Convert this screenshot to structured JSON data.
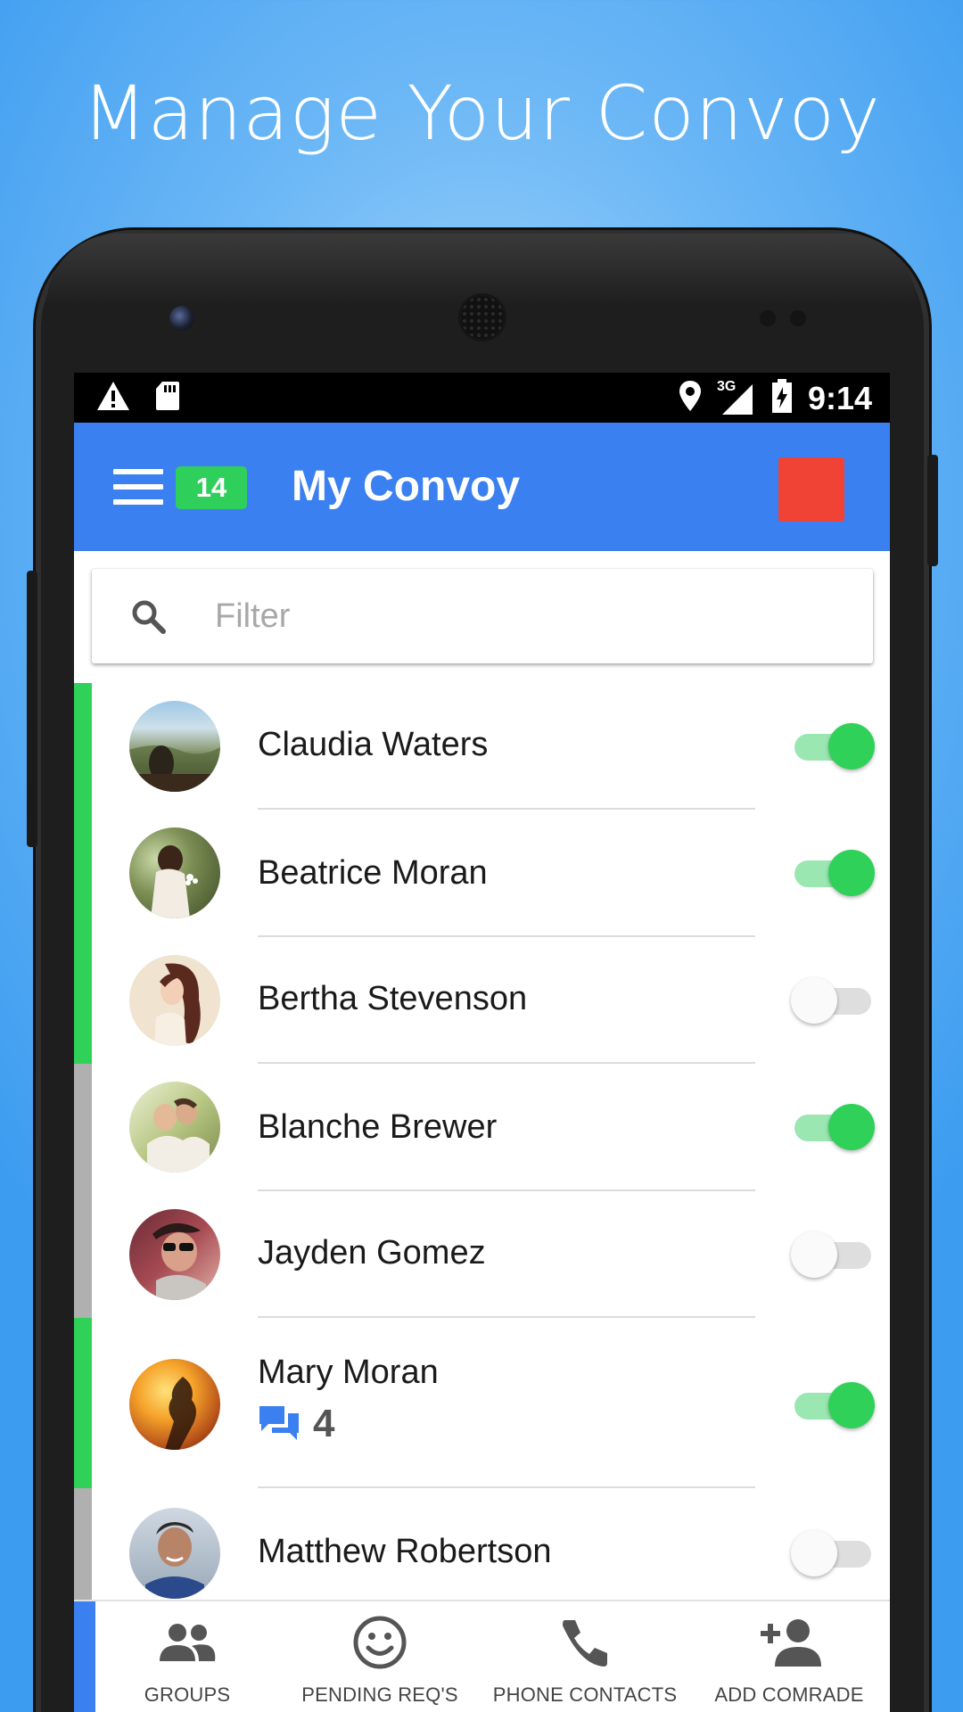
{
  "headline": "Manage Your Convoy",
  "status_bar": {
    "time": "9:14",
    "network": "3G"
  },
  "app_bar": {
    "badge_count": "14",
    "title": "My Convoy"
  },
  "filter": {
    "placeholder": "Filter",
    "value": ""
  },
  "colors": {
    "accent_blue": "#3b80f0",
    "online_green": "#2fd158",
    "offline_gray": "#b0b0b0",
    "alert_red": "#f04336"
  },
  "contacts": [
    {
      "name": "Claudia Waters",
      "enabled": true,
      "stripe": "green",
      "avatar": "landscape-avatar"
    },
    {
      "name": "Beatrice Moran",
      "enabled": true,
      "stripe": "green",
      "avatar": "woman-flowers-avatar"
    },
    {
      "name": "Bertha Stevenson",
      "enabled": false,
      "stripe": "green",
      "avatar": "woman-illustration-avatar"
    },
    {
      "name": "Blanche Brewer",
      "enabled": true,
      "stripe": "gray",
      "avatar": "couple-avatar"
    },
    {
      "name": "Jayden Gomez",
      "enabled": false,
      "stripe": "gray",
      "avatar": "man-sunglasses-avatar"
    },
    {
      "name": "Mary Moran",
      "enabled": true,
      "stripe": "green",
      "avatar": "sunset-silhouette-avatar",
      "messages": "4"
    },
    {
      "name": "Matthew Robertson",
      "enabled": false,
      "stripe": "gray",
      "avatar": "man-portrait-avatar"
    }
  ],
  "bottom_nav": [
    {
      "label": "GROUPS",
      "icon": "groups-icon"
    },
    {
      "label": "PENDING REQ'S",
      "icon": "smiley-icon"
    },
    {
      "label": "PHONE CONTACTS",
      "icon": "phone-icon"
    },
    {
      "label": "ADD COMRADE",
      "icon": "add-person-icon"
    }
  ]
}
